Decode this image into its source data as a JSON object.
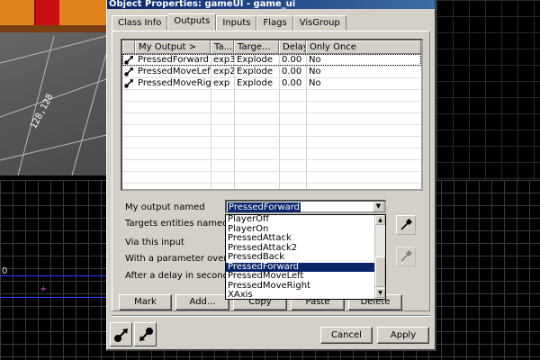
{
  "window": {
    "title": "Object Properties: gameUI - game_ui"
  },
  "tabs": [
    {
      "label": "Class Info"
    },
    {
      "label": "Outputs"
    },
    {
      "label": "Inputs"
    },
    {
      "label": "Flags"
    },
    {
      "label": "VisGroup"
    }
  ],
  "active_tab": "Outputs",
  "outputs_table": {
    "columns": [
      "My Output  >",
      "Ta...",
      "Targe...",
      "Delay",
      "Only Once"
    ],
    "rows": [
      {
        "output": "PressedForward",
        "target": "exp3",
        "input": "Explode",
        "delay": "0.00",
        "only_once": "No"
      },
      {
        "output": "PressedMoveLeft",
        "target": "exp2",
        "input": "Explode",
        "delay": "0.00",
        "only_once": "No"
      },
      {
        "output": "PressedMoveRight",
        "target": "exp",
        "input": "Explode",
        "delay": "0.00",
        "only_once": "No"
      }
    ]
  },
  "form": {
    "output_label": "My output named",
    "targets_label": "Targets entities named",
    "via_label": "Via this input",
    "param_label": "With a parameter override of",
    "delay_label": "After a delay in seconds of",
    "output_value": "PressedForward"
  },
  "dropdown": {
    "items": [
      "PlayerOff",
      "PlayerOn",
      "PressedAttack",
      "PressedAttack2",
      "PressedBack",
      "PressedForward",
      "PressedMoveLeft",
      "PressedMoveRight",
      "XAxis"
    ],
    "selected": "PressedForward"
  },
  "buttons": {
    "mark": "Mark",
    "add": "Add...",
    "copy": "Copy",
    "paste": "Paste",
    "delete": "Delete",
    "cancel": "Cancel",
    "apply": "Apply"
  },
  "background": {
    "viewport_coord": "128,128",
    "top_view_label": "0"
  },
  "colors": {
    "title_bar": "#0a246a",
    "selection": "#0a246a",
    "dialog_face": "#d4d0c8"
  },
  "icons": {
    "output_row": "output-arrow-icon",
    "eyedropper": "eyedropper-icon"
  }
}
